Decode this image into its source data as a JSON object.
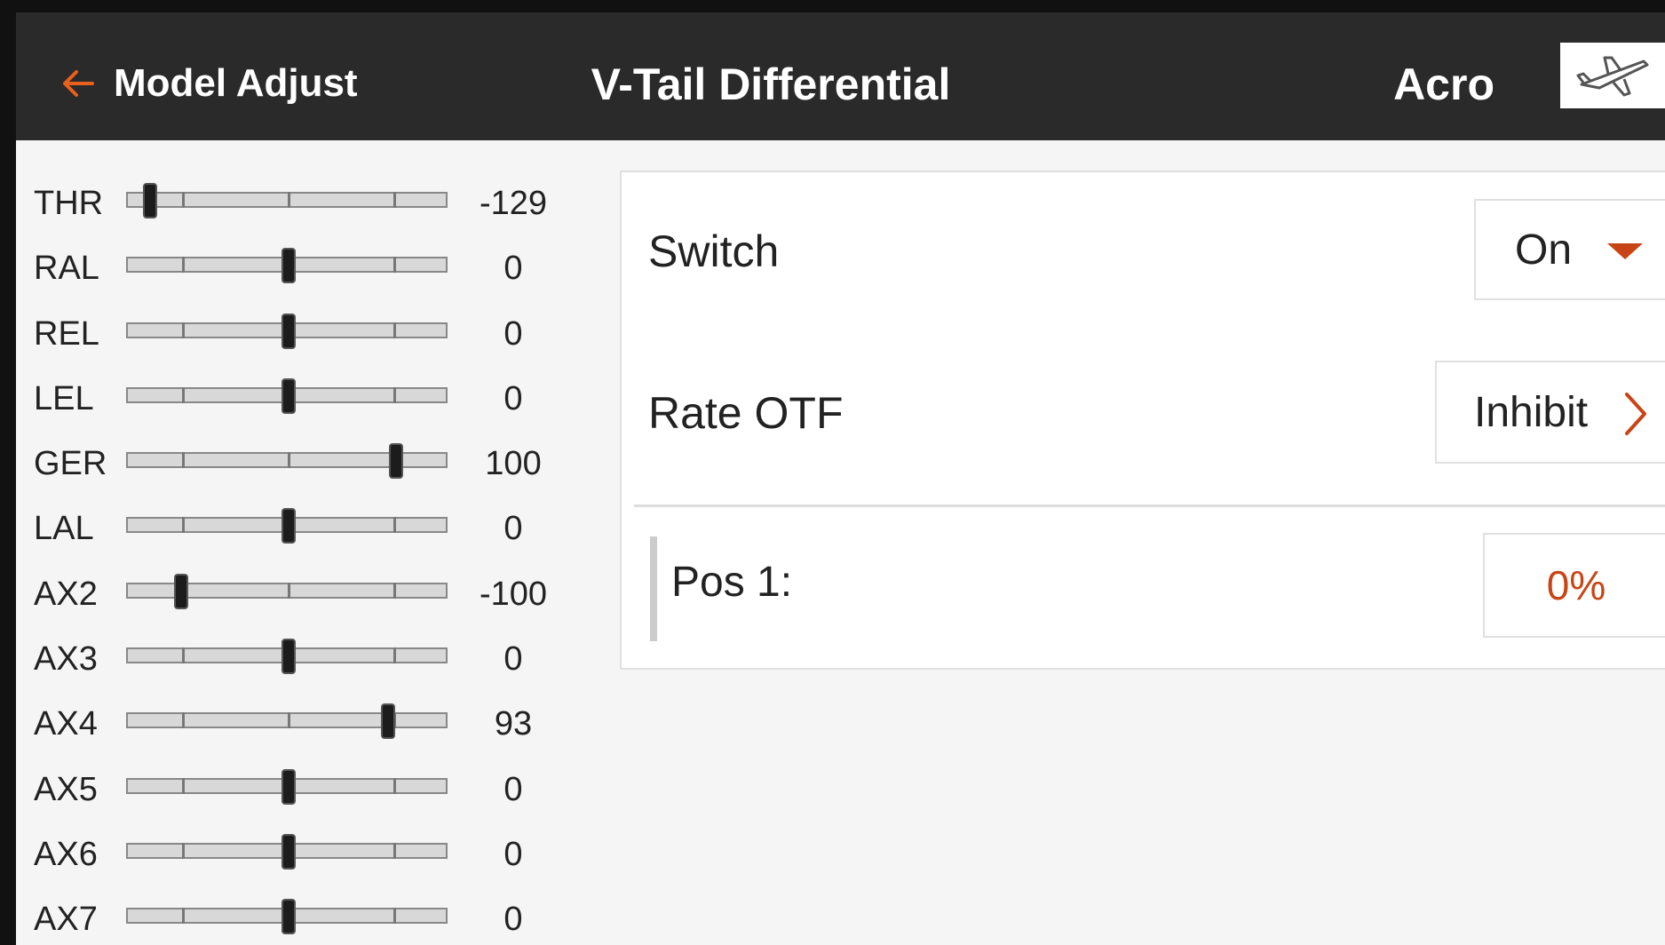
{
  "header": {
    "back_label": "Model Adjust",
    "title": "V-Tail Differential",
    "model_name": "Acro",
    "model_icon": "airplane-icon"
  },
  "channels": [
    {
      "label": "THR",
      "value": "-129",
      "position_pct": -129
    },
    {
      "label": "RAL",
      "value": "0",
      "position_pct": 0
    },
    {
      "label": "REL",
      "value": "0",
      "position_pct": 0
    },
    {
      "label": "LEL",
      "value": "0",
      "position_pct": 0
    },
    {
      "label": "GER",
      "value": "100",
      "position_pct": 100
    },
    {
      "label": "LAL",
      "value": "0",
      "position_pct": 0
    },
    {
      "label": "AX2",
      "value": "-100",
      "position_pct": -100
    },
    {
      "label": "AX3",
      "value": "0",
      "position_pct": 0
    },
    {
      "label": "AX4",
      "value": "93",
      "position_pct": 93
    },
    {
      "label": "AX5",
      "value": "0",
      "position_pct": 0
    },
    {
      "label": "AX6",
      "value": "0",
      "position_pct": 0
    },
    {
      "label": "AX7",
      "value": "0",
      "position_pct": 0
    }
  ],
  "settings": {
    "switch": {
      "label": "Switch",
      "value": "On"
    },
    "rate_otf": {
      "label": "Rate OTF",
      "value": "Inhibit"
    },
    "pos1": {
      "label": "Pos 1:",
      "value": "0%"
    }
  },
  "colors": {
    "accent": "#c84414",
    "header_bg": "#2a2a2a"
  }
}
